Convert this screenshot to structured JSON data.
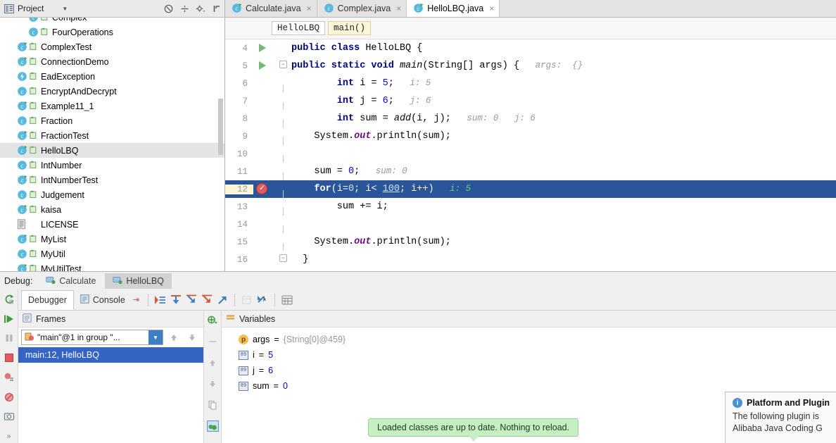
{
  "project_panel": {
    "title": "Project",
    "dropdown_icon": "chevron-down-icon",
    "tools": [
      {
        "name": "collapse-all-icon",
        "glyph": "⊖"
      },
      {
        "name": "scroll-from-source-icon",
        "glyph": "÷"
      },
      {
        "name": "settings-gear-icon",
        "glyph": "✲"
      },
      {
        "name": "hide-panel-icon",
        "glyph": "⊩"
      }
    ],
    "tree": [
      {
        "label": "Complex",
        "icon": "java-class-icon",
        "indent": 36,
        "selected": false,
        "clipped": true,
        "has_sub": true
      },
      {
        "label": "FourOperations",
        "icon": "java-class-icon",
        "indent": 36,
        "selected": false,
        "has_sub": true
      },
      {
        "label": "ComplexTest",
        "icon": "java-class-runnable-icon",
        "indent": 20,
        "selected": false,
        "has_sub": true
      },
      {
        "label": "ConnectionDemo",
        "icon": "java-class-runnable-icon",
        "indent": 20,
        "selected": false,
        "has_sub": true
      },
      {
        "label": "EadException",
        "icon": "java-exception-icon",
        "indent": 20,
        "selected": false,
        "has_sub": true
      },
      {
        "label": "EncryptAndDecrypt",
        "icon": "java-class-icon",
        "indent": 20,
        "selected": false,
        "has_sub": true
      },
      {
        "label": "Example11_1",
        "icon": "java-class-runnable-icon",
        "indent": 20,
        "selected": false,
        "has_sub": true
      },
      {
        "label": "Fraction",
        "icon": "java-class-icon",
        "indent": 20,
        "selected": false,
        "has_sub": true
      },
      {
        "label": "FractionTest",
        "icon": "java-class-runnable-icon",
        "indent": 20,
        "selected": false,
        "has_sub": true
      },
      {
        "label": "HelloLBQ",
        "icon": "java-class-runnable-icon",
        "indent": 20,
        "selected": true,
        "has_sub": true
      },
      {
        "label": "IntNumber",
        "icon": "java-class-icon",
        "indent": 20,
        "selected": false,
        "has_sub": true
      },
      {
        "label": "IntNumberTest",
        "icon": "java-class-runnable-icon",
        "indent": 20,
        "selected": false,
        "has_sub": true
      },
      {
        "label": "Judgement",
        "icon": "java-class-icon",
        "indent": 20,
        "selected": false,
        "has_sub": true
      },
      {
        "label": "kaisa",
        "icon": "java-class-runnable-icon",
        "indent": 20,
        "selected": false,
        "has_sub": true
      },
      {
        "label": "LICENSE",
        "icon": "text-file-icon",
        "indent": 20,
        "selected": false,
        "has_sub": false
      },
      {
        "label": "MyList",
        "icon": "java-class-runnable-icon",
        "indent": 20,
        "selected": false,
        "has_sub": true
      },
      {
        "label": "MyUtil",
        "icon": "java-class-icon",
        "indent": 20,
        "selected": false,
        "has_sub": true
      },
      {
        "label": "MyUtilTest",
        "icon": "java-class-runnable-icon",
        "indent": 20,
        "selected": false,
        "has_sub": true
      }
    ]
  },
  "editor": {
    "tabs": [
      {
        "label": "Calculate.java",
        "icon": "java-class-runnable-icon",
        "active": false,
        "closable": true
      },
      {
        "label": "Complex.java",
        "icon": "java-class-icon",
        "active": false,
        "closable": true
      },
      {
        "label": "HelloLBQ.java",
        "icon": "java-class-runnable-icon",
        "active": true,
        "closable": true
      }
    ],
    "breadcrumbs": [
      {
        "label": "HelloLBQ",
        "highlight": false
      },
      {
        "label": "main()",
        "highlight": true
      }
    ],
    "highlight_color": "#2a5699",
    "lines": [
      {
        "num": "4",
        "gutter": "run-arrow",
        "fold": "none",
        "html": "<span class='kw'>public class</span> HelloLBQ {",
        "highlighted": false
      },
      {
        "num": "5",
        "gutter": "run-arrow",
        "fold": "open",
        "html": "<span class='kw'>public static void</span> <span class='mth'>main</span>(String[] args) {<span class='hint'>   args:  {}</span>",
        "highlighted": false
      },
      {
        "num": "6",
        "gutter": "none",
        "fold": "line",
        "html": "        <span class='kw'>int</span> i = <span class='num'>5</span>;<span class='hint'>   i: 5</span>",
        "highlighted": false
      },
      {
        "num": "7",
        "gutter": "none",
        "fold": "line",
        "html": "        <span class='kw'>int</span> j = <span class='num'>6</span>;<span class='hint'>   j: 6</span>",
        "highlighted": false
      },
      {
        "num": "8",
        "gutter": "none",
        "fold": "line",
        "html": "        <span class='kw'>int</span> sum = <span class='mth'>add</span>(i, j);<span class='hint'>   sum: 0   j: 6</span>",
        "highlighted": false
      },
      {
        "num": "9",
        "gutter": "none",
        "fold": "line",
        "html": "    System.<span class='fld'>out</span>.println(sum);",
        "highlighted": false
      },
      {
        "num": "10",
        "gutter": "none",
        "fold": "line",
        "html": "",
        "highlighted": false
      },
      {
        "num": "11",
        "gutter": "none",
        "fold": "line",
        "html": "    sum = <span class='num'>0</span>;<span class='hint'>   sum: 0</span>",
        "highlighted": false
      },
      {
        "num": "12",
        "gutter": "breakpoint",
        "fold": "line",
        "html": "    <span class='kw'>for</span>(i=<span class='num'>0</span>; i&lt; <span class='num underline-wavy'>100</span>; i++)<span class='hint-green'>   i: 5</span>",
        "highlighted": true
      },
      {
        "num": "13",
        "gutter": "none",
        "fold": "line",
        "html": "        sum += i;",
        "highlighted": false
      },
      {
        "num": "14",
        "gutter": "none",
        "fold": "line",
        "html": "",
        "highlighted": false
      },
      {
        "num": "15",
        "gutter": "none",
        "fold": "line",
        "html": "    System.<span class='fld'>out</span>.println(sum);",
        "highlighted": false
      },
      {
        "num": "16",
        "gutter": "none",
        "fold": "close",
        "html": "  }",
        "highlighted": false
      }
    ]
  },
  "debug": {
    "label": "Debug:",
    "session_tabs": [
      {
        "label": "Calculate",
        "icon": "debug-session-icon",
        "active": false
      },
      {
        "label": "HelloLBQ",
        "icon": "debug-session-icon",
        "active": true
      }
    ],
    "view_tabs": [
      {
        "label": "Debugger",
        "icon": "",
        "active": true
      },
      {
        "label": "Console",
        "icon": "console-icon",
        "active": false
      }
    ],
    "console_pin_icon": "pin-tab-icon",
    "step_buttons": [
      {
        "name": "show-execution-point-icon",
        "enabled": true
      },
      {
        "name": "step-over-icon",
        "enabled": true
      },
      {
        "name": "step-into-icon",
        "enabled": true
      },
      {
        "name": "force-step-into-icon",
        "enabled": true
      },
      {
        "name": "step-out-icon",
        "enabled": true
      },
      {
        "name": "drop-frame-icon",
        "enabled": false
      },
      {
        "name": "run-to-cursor-icon",
        "enabled": true
      },
      {
        "name": "evaluate-expression-icon",
        "enabled": true
      }
    ],
    "left_rail": [
      {
        "name": "rerun-debug-icon"
      },
      {
        "name": "resume-program-icon"
      },
      {
        "name": "pause-program-icon"
      },
      {
        "name": "stop-program-icon"
      },
      {
        "name": "view-breakpoints-icon"
      },
      {
        "name": "mute-breakpoints-icon"
      },
      {
        "name": "settings-camera-icon"
      },
      {
        "name": "expand-more-icon"
      }
    ],
    "frames": {
      "title": "Frames",
      "pin_icon": "pin-tab-icon",
      "thread_selector": "\"main\"@1 in group \"...",
      "thread_icon": "thread-running-icon",
      "toolbar": [
        {
          "name": "frames-up-icon"
        },
        {
          "name": "frames-down-icon"
        },
        {
          "name": "filter-frames-icon"
        }
      ],
      "rows": [
        {
          "label": "main:12, HelloLBQ",
          "selected": true
        }
      ]
    },
    "variables": {
      "title": "Variables",
      "title_icon": "variables-icon",
      "rail": [
        {
          "name": "add-watch-icon"
        },
        {
          "name": "remove-watch-icon"
        },
        {
          "name": "move-watch-up-icon"
        },
        {
          "name": "move-watch-down-icon"
        },
        {
          "name": "copy-value-icon"
        },
        {
          "name": "inspect-icon"
        }
      ],
      "rows": [
        {
          "icon": "parameter-icon",
          "icon_glyph": "p",
          "name": "args",
          "value": "{String[0]@459}",
          "value_kind": "ref"
        },
        {
          "icon": "primitive-icon",
          "icon_glyph": "89",
          "name": "i",
          "value": "5",
          "value_kind": "num"
        },
        {
          "icon": "primitive-icon",
          "icon_glyph": "89",
          "name": "j",
          "value": "6",
          "value_kind": "num"
        },
        {
          "icon": "primitive-icon",
          "icon_glyph": "89",
          "name": "sum",
          "value": "0",
          "value_kind": "num"
        }
      ],
      "separator": "="
    }
  },
  "toast": {
    "text": "Loaded classes are up to date. Nothing to reload.",
    "background": "#c6f0c4"
  },
  "notification": {
    "icon": "info-icon",
    "title": "Platform and Plugin",
    "line1": "The following plugin is",
    "line2": "Alibaba Java Coding G"
  }
}
